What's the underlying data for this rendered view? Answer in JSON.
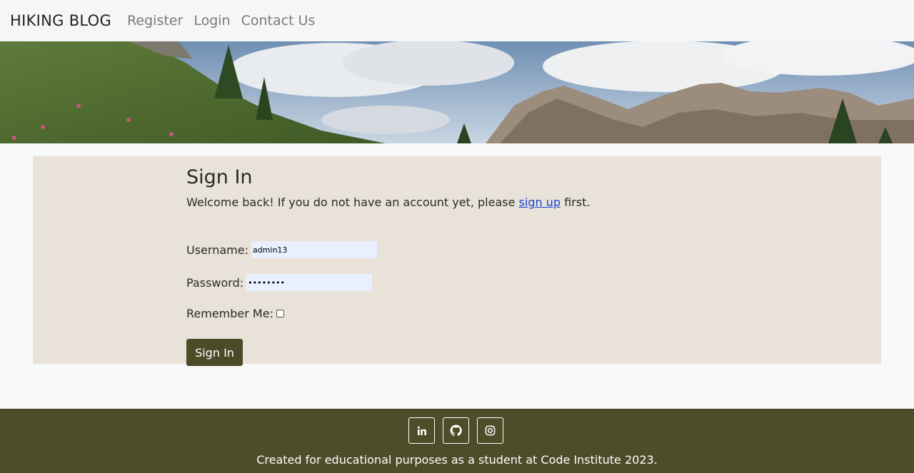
{
  "nav": {
    "brand": "HIKING BLOG",
    "links": [
      "Register",
      "Login",
      "Contact Us"
    ]
  },
  "hero": {
    "image": "mountain-landscape"
  },
  "signin": {
    "title": "Sign In",
    "intro_prefix": "Welcome back! If you do not have an account yet, please ",
    "intro_link": "sign up",
    "intro_suffix": " first.",
    "username_label": "Username:",
    "username_value": "admin13",
    "password_label": "Password:",
    "password_value": "••••••••",
    "remember_label": "Remember Me:",
    "remember_checked": false,
    "submit_label": "Sign In"
  },
  "footer": {
    "social_icons": [
      "linkedin-icon",
      "github-icon",
      "instagram-icon"
    ],
    "text": "Created for educational purposes as a student at Code Institute 2023."
  },
  "colors": {
    "nav_bg": "#f5f6f8",
    "card_bg": "#e8e2d8",
    "button_bg": "#4b4b27",
    "footer_bg": "#4d4d29",
    "link": "#1a44d6",
    "input_bg": "#e8f0fe"
  }
}
